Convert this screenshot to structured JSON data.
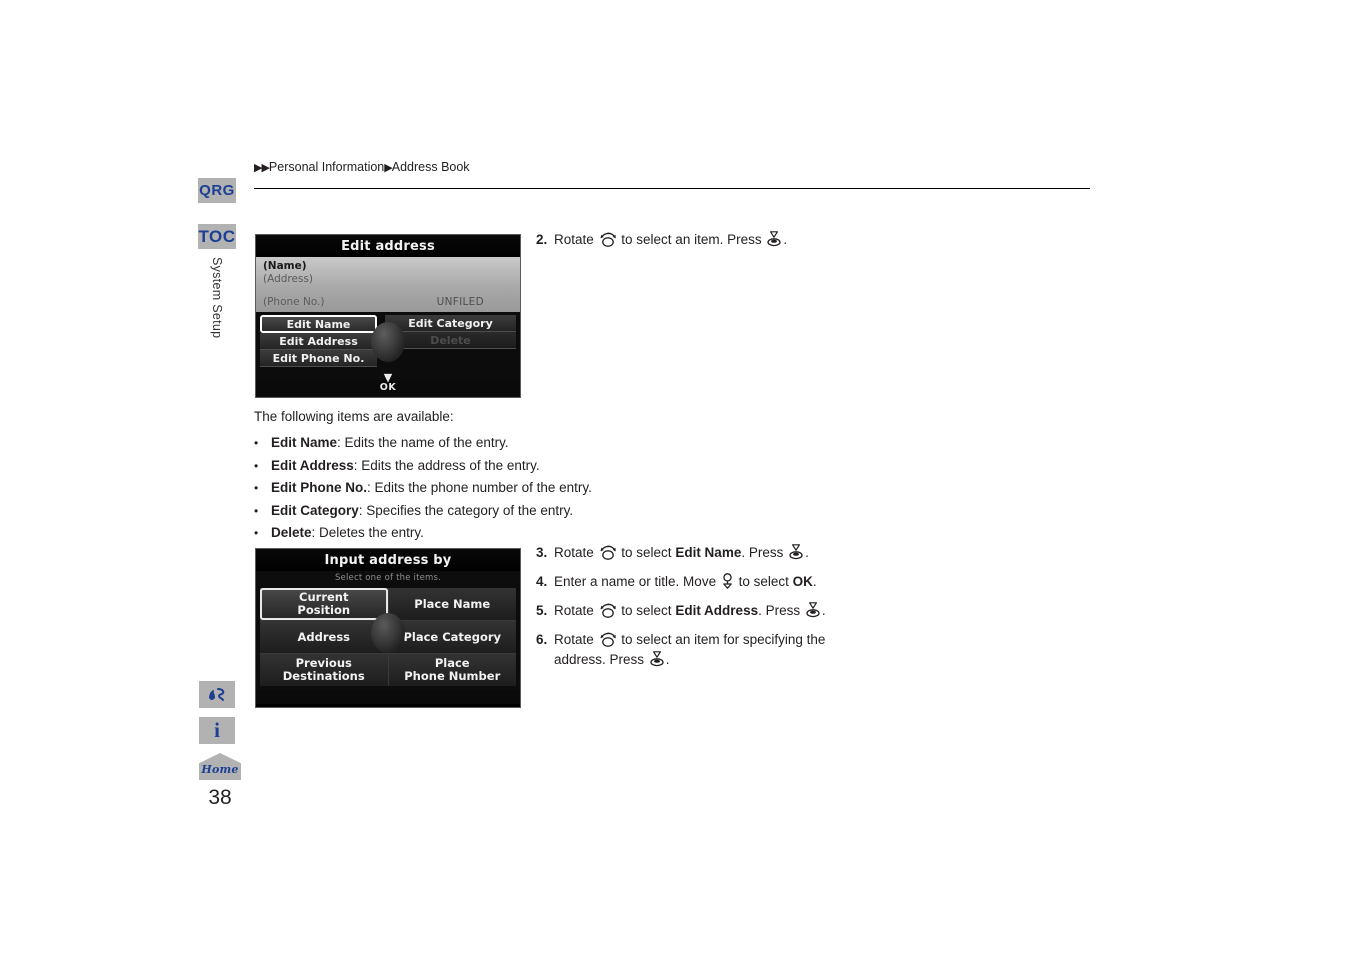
{
  "rail": {
    "tabs": [
      {
        "id": "qrg",
        "label": "QRG"
      },
      {
        "id": "toc",
        "label": "TOC"
      }
    ],
    "vertical_label": "System Setup",
    "bottom_icons": [
      {
        "id": "voice",
        "name": "voice-command-icon",
        "label": ""
      },
      {
        "id": "info",
        "name": "information-icon",
        "label": "i"
      },
      {
        "id": "home",
        "name": "home-icon",
        "label": "Home"
      }
    ],
    "page_number": "38"
  },
  "header": {
    "breadcrumb": [
      {
        "arrow": "▶▶",
        "label": "Personal Information"
      },
      {
        "arrow": "▶",
        "label": "Address Book"
      }
    ],
    "breadcrumb_full": "▶▶Personal Information▶Address Book"
  },
  "nav_screen_1": {
    "title": "Edit address",
    "info": {
      "name": "(Name)",
      "address": "(Address)",
      "phone": "(Phone No.)",
      "category": "UNFILED"
    },
    "left_buttons": [
      {
        "label": "Edit Name",
        "selected": true,
        "dimmed": false
      },
      {
        "label": "Edit Address",
        "selected": false,
        "dimmed": false
      },
      {
        "label": "Edit Phone No.",
        "selected": false,
        "dimmed": false
      }
    ],
    "right_buttons": [
      {
        "label": "Edit Category",
        "selected": false,
        "dimmed": false
      },
      {
        "label": "Delete",
        "selected": false,
        "dimmed": true
      }
    ],
    "ok_label": "OK",
    "ok_arrow": "▼"
  },
  "nav_screen_2": {
    "title": "Input address by",
    "subtitle": "Select one of the items.",
    "cells": [
      {
        "label": "Current\nPosition",
        "selected": true
      },
      {
        "label": "Place Name",
        "selected": false
      },
      {
        "label": "Address",
        "selected": false
      },
      {
        "label": "Place Category",
        "selected": false
      },
      {
        "label": "Previous\nDestinations",
        "selected": false
      },
      {
        "label": "Place\nPhone Number",
        "selected": false
      }
    ]
  },
  "body": {
    "intro": "The following items are available:",
    "bullet_marker": "•",
    "bullets": [
      {
        "term": "Edit Name",
        "desc": ": Edits the name of the entry."
      },
      {
        "term": "Edit Address",
        "desc": ": Edits the address of the entry."
      },
      {
        "term": "Edit Phone No.",
        "desc": ": Edits the phone number of the entry."
      },
      {
        "term": "Edit Category",
        "desc": ": Specifies the category of the entry."
      },
      {
        "term": "Delete",
        "desc": ": Deletes the entry."
      }
    ]
  },
  "steps_top": [
    {
      "num": "2.",
      "parts": [
        {
          "t": "text",
          "v": "Rotate "
        },
        {
          "t": "icon",
          "v": "rotate-knob-icon"
        },
        {
          "t": "text",
          "v": " to select an item. Press "
        },
        {
          "t": "icon",
          "v": "press-knob-icon"
        },
        {
          "t": "text",
          "v": "."
        }
      ],
      "plain": "Rotate ⊙ to select an item. Press ⊙."
    }
  ],
  "steps_bottom": [
    {
      "num": "3.",
      "parts": [
        {
          "t": "text",
          "v": "Rotate "
        },
        {
          "t": "icon",
          "v": "rotate-knob-icon"
        },
        {
          "t": "text",
          "v": " to select "
        },
        {
          "t": "bold",
          "v": "Edit Name"
        },
        {
          "t": "text",
          "v": ". Press "
        },
        {
          "t": "icon",
          "v": "press-knob-icon"
        },
        {
          "t": "text",
          "v": "."
        }
      ]
    },
    {
      "num": "4.",
      "parts": [
        {
          "t": "text",
          "v": "Enter a name or title. Move "
        },
        {
          "t": "icon",
          "v": "joystick-icon"
        },
        {
          "t": "text",
          "v": " to select "
        },
        {
          "t": "bold",
          "v": "OK"
        },
        {
          "t": "text",
          "v": "."
        }
      ]
    },
    {
      "num": "5.",
      "parts": [
        {
          "t": "text",
          "v": "Rotate "
        },
        {
          "t": "icon",
          "v": "rotate-knob-icon"
        },
        {
          "t": "text",
          "v": " to select "
        },
        {
          "t": "bold",
          "v": "Edit Address"
        },
        {
          "t": "text",
          "v": ". Press "
        },
        {
          "t": "icon",
          "v": "press-knob-icon"
        },
        {
          "t": "text",
          "v": "."
        }
      ]
    },
    {
      "num": "6.",
      "parts": [
        {
          "t": "text",
          "v": "Rotate "
        },
        {
          "t": "icon",
          "v": "rotate-knob-icon"
        },
        {
          "t": "text",
          "v": " to select an item for specifying the address. Press "
        },
        {
          "t": "icon",
          "v": "press-knob-icon"
        },
        {
          "t": "text",
          "v": "."
        }
      ]
    }
  ],
  "colors": {
    "tab_bg": "#b2b2b2",
    "tab_text": "#1c3f94",
    "body_text": "#231f20",
    "rule": "#000000"
  }
}
